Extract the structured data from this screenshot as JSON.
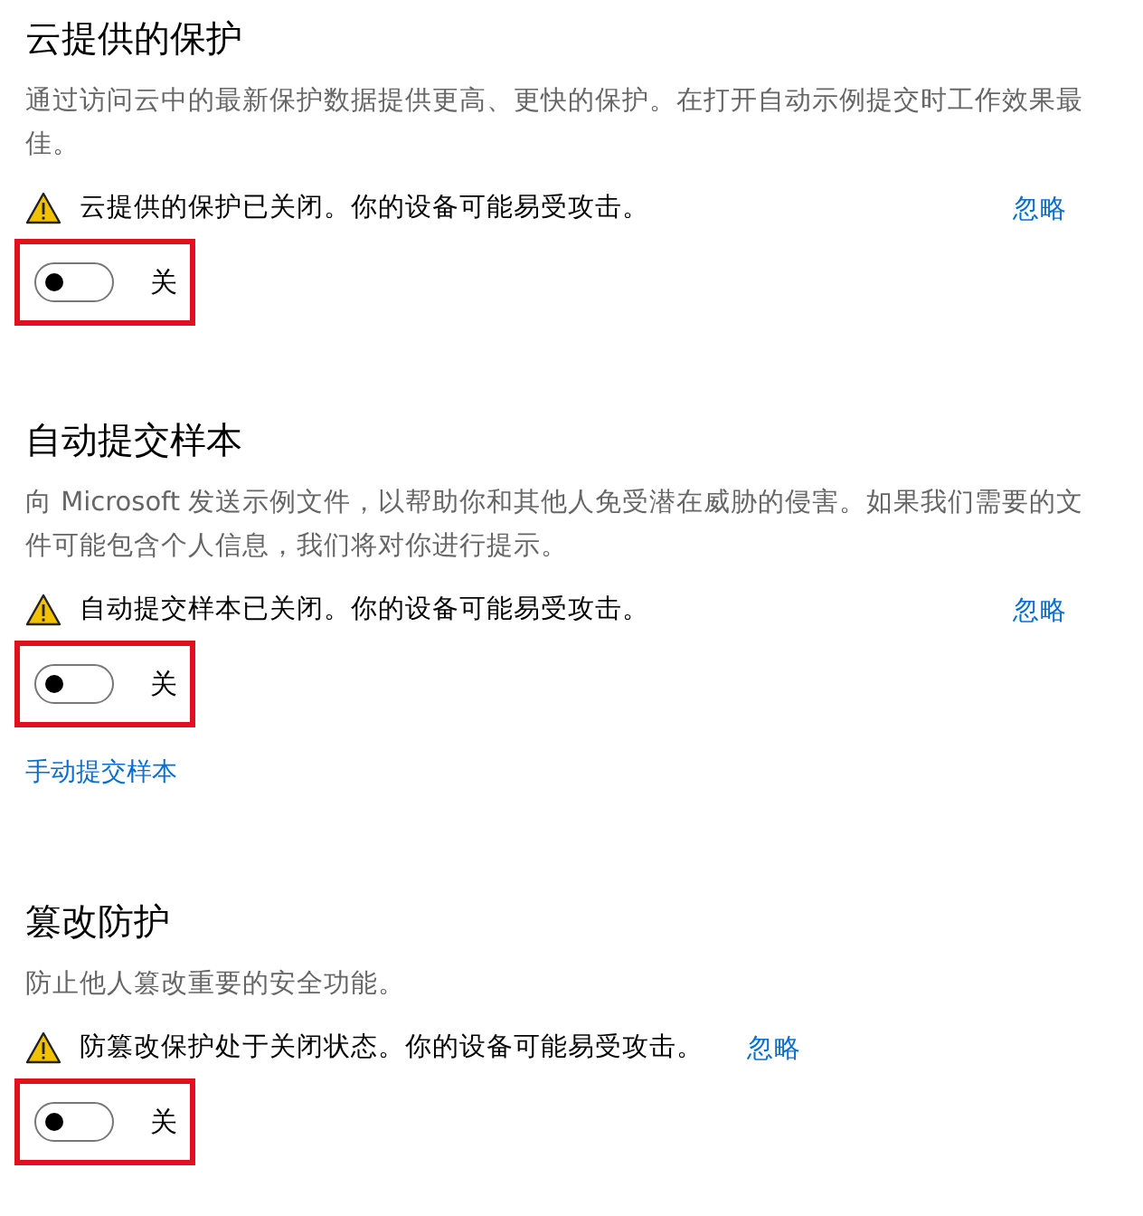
{
  "sections": [
    {
      "title": "云提供的保护",
      "description": "通过访问云中的最新保护数据提供更高、更快的保护。在打开自动示例提交时工作效果最佳。",
      "warning": {
        "text": "云提供的保护已关闭。你的设备可能易受攻击。",
        "dismiss": "忽略"
      },
      "toggle": {
        "on": false,
        "label": "关",
        "highlighted": true
      }
    },
    {
      "title": "自动提交样本",
      "description": "向 Microsoft 发送示例文件，以帮助你和其他人免受潜在威胁的侵害。如果我们需要的文件可能包含个人信息，我们将对你进行提示。",
      "warning": {
        "text": "自动提交样本已关闭。你的设备可能易受攻击。",
        "dismiss": "忽略"
      },
      "toggle": {
        "on": false,
        "label": "关",
        "highlighted": true
      },
      "link": "手动提交样本"
    },
    {
      "title": "篡改防护",
      "description": "防止他人篡改重要的安全功能。",
      "warning": {
        "text": "防篡改保护处于关闭状态。你的设备可能易受攻击。",
        "dismiss": "忽略"
      },
      "toggle": {
        "on": false,
        "label": "关",
        "highlighted": true
      }
    }
  ]
}
